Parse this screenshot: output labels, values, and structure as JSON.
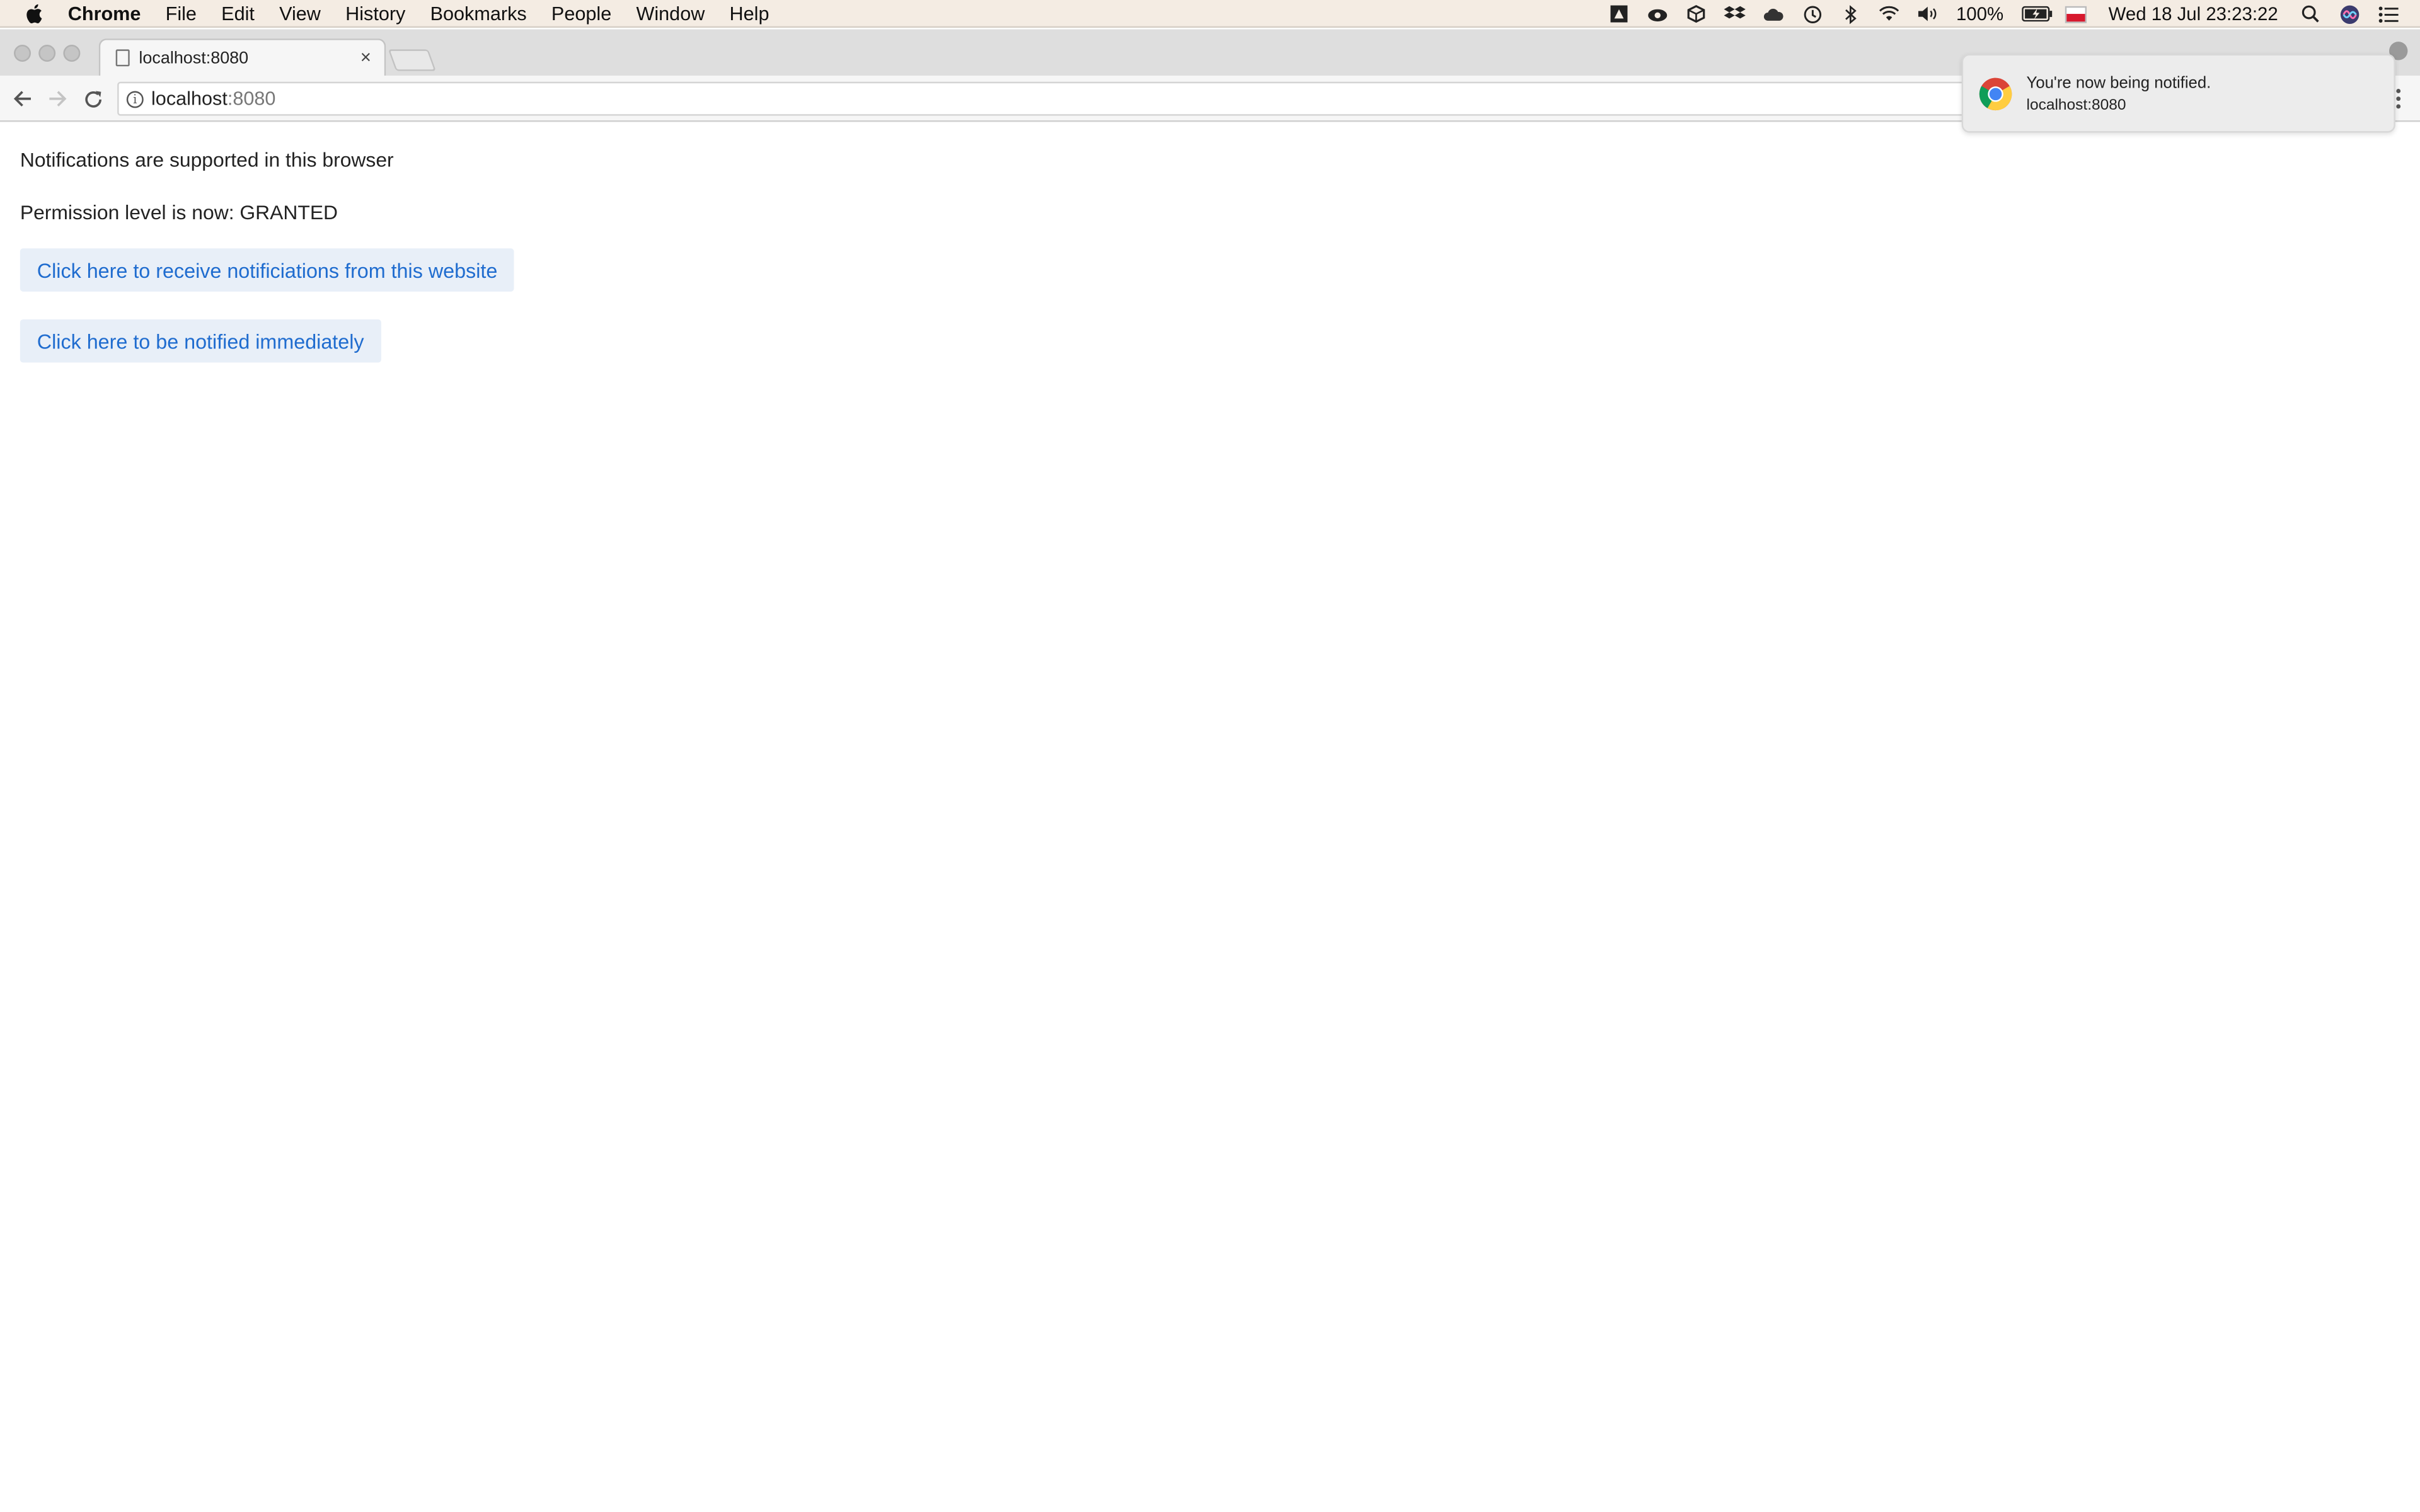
{
  "menubar": {
    "app_name": "Chrome",
    "items": [
      "File",
      "Edit",
      "View",
      "History",
      "Bookmarks",
      "People",
      "Window",
      "Help"
    ],
    "battery": "100%",
    "datetime": "Wed 18 Jul  23:23:22"
  },
  "tab": {
    "title": "localhost:8080",
    "close_glyph": "×"
  },
  "toolbar": {
    "url_host": "localhost",
    "url_port": ":8080"
  },
  "page": {
    "support_text": "Notifications are supported in this browser",
    "permission_text": "Permission level is now: GRANTED",
    "receive_button": "Click here to receive notificiations from this website",
    "notify_button": "Click here to be notified immediately"
  },
  "notification": {
    "title": "You're now being notified.",
    "origin": "localhost:8080"
  },
  "colors": {
    "link_blue": "#1f6ccf",
    "button_bg": "#e8eff8",
    "menubar_bg": "#f4ece3"
  }
}
